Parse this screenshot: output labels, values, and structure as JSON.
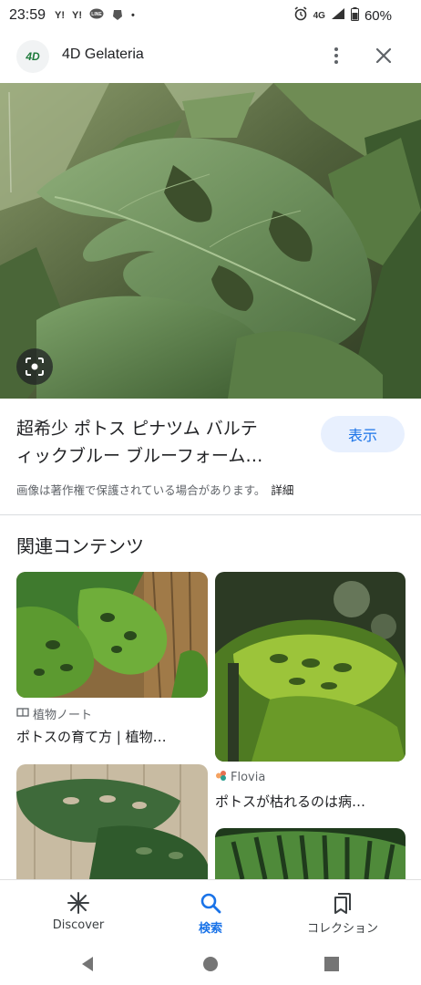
{
  "status_bar": {
    "time": "23:59",
    "notif_icons": [
      "Y!",
      "Y!",
      "LINE",
      "app",
      "•"
    ],
    "network": "4G",
    "battery": "60%"
  },
  "header": {
    "logo_text": "4D",
    "site_name": "4D Gelateria"
  },
  "result": {
    "title_line1": "超希少 ポトス ピナツム バルテ",
    "title_line2": "ィックブルー ブルーフォーム…",
    "show_button": "表示",
    "copyright": "画像は著作権で保護されている場合があります。",
    "detail_link": "詳細"
  },
  "related": {
    "heading": "関連コンテンツ",
    "cards": [
      {
        "source": "植物ノート",
        "title": "ポトスの育て方 | 植物…"
      },
      {
        "source": "Flovia",
        "title": "ポトスが枯れるのは病…"
      }
    ]
  },
  "bottom_nav": {
    "items": [
      {
        "label": "Discover",
        "icon": "asterisk-icon"
      },
      {
        "label": "検索",
        "icon": "search-icon"
      },
      {
        "label": "コレクション",
        "icon": "collections-icon"
      }
    ]
  },
  "colors": {
    "accent": "#1a73e8",
    "button_bg": "#e8f0fe"
  }
}
